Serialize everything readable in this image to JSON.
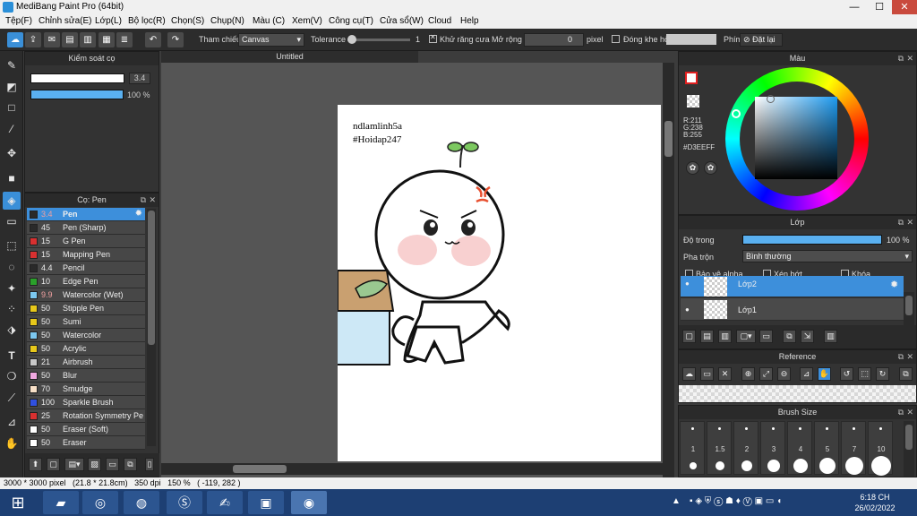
{
  "window": {
    "title": "MediBang Paint Pro (64bit)",
    "minimize": "—",
    "maximize": "☐",
    "close": "✕"
  },
  "menu": [
    "Tệp(F)",
    "Chỉnh sửa(E)",
    "Lớp(L)",
    "Bộ lọc(R)",
    "Chọn(S)",
    "Chụp(N)",
    "Màu (C)",
    "Xem(V)",
    "Công cụ(T)",
    "Cửa sổ(W)",
    "Cloud",
    "Help"
  ],
  "toolbar": {
    "reference_label": "Tham chiếu",
    "reference_value": "Canvas",
    "tolerance_label": "Tolerance",
    "tolerance_value": "1",
    "antialias_label": "Khử răng cưa",
    "expand_label": "Mở rộng",
    "expand_value": "0",
    "expand_unit": "pixel",
    "gap_label": "Đóng khe hở",
    "key_label": "Phím",
    "reset_label": "Đặt lại"
  },
  "brush_control": {
    "title": "Kiểm soát cọ",
    "size": "3.4",
    "opacity": "100 %",
    "size_fraction": 0.95,
    "opacity_fraction": 1.0
  },
  "brush_panel": {
    "title": "Cọ: Pen",
    "brushes": [
      {
        "size": "3.4",
        "name": "Pen",
        "color": "#2a2a2a"
      },
      {
        "size": "45",
        "name": "Pen (Sharp)",
        "color": "#2a2a2a"
      },
      {
        "size": "15",
        "name": "G Pen",
        "color": "#d83030"
      },
      {
        "size": "15",
        "name": "Mapping Pen",
        "color": "#d83030"
      },
      {
        "size": "4.4",
        "name": "Pencil",
        "color": "#2a2a2a"
      },
      {
        "size": "10",
        "name": "Edge Pen",
        "color": "#2aa02a"
      },
      {
        "size": "9.9",
        "name": "Watercolor (Wet)",
        "color": "#7cc8f0"
      },
      {
        "size": "50",
        "name": "Stipple Pen",
        "color": "#e8c81a"
      },
      {
        "size": "50",
        "name": "Sumi",
        "color": "#e8c81a"
      },
      {
        "size": "50",
        "name": "Watercolor",
        "color": "#7cc8f0"
      },
      {
        "size": "50",
        "name": "Acrylic",
        "color": "#e8c81a"
      },
      {
        "size": "21",
        "name": "Airbrush",
        "color": "#c8c8c8"
      },
      {
        "size": "50",
        "name": "Blur",
        "color": "#f0a8e0"
      },
      {
        "size": "70",
        "name": "Smudge",
        "color": "#f8e0c8"
      },
      {
        "size": "100",
        "name": "Sparkle Brush",
        "color": "#3050e0"
      },
      {
        "size": "25",
        "name": "Rotation Symmetry Pe",
        "color": "#d83030"
      },
      {
        "size": "50",
        "name": "Eraser (Soft)",
        "color": "#ffffff"
      },
      {
        "size": "50",
        "name": "Eraser",
        "color": "#ffffff"
      }
    ]
  },
  "document": {
    "tab": "Untitled",
    "text1": "ndlamlinh5a",
    "text2": "#Hoidap247"
  },
  "color_panel": {
    "title": "Màu",
    "r": "R:211",
    "g": "G:238",
    "b": "B:255",
    "hex": "#D3EEFF"
  },
  "layer_panel": {
    "title": "Lớp",
    "opacity_label": "Độ trong",
    "opacity_value": "100 %",
    "blend_label": "Pha trộn",
    "blend_value": "Bình thường",
    "protect_alpha": "Bảo vệ alpha",
    "clipping": "Xén bớt",
    "lock": "Khóa",
    "layers": [
      "Lớp2",
      "Lớp1"
    ]
  },
  "reference_panel": {
    "title": "Reference"
  },
  "brush_size_panel": {
    "title": "Brush Size",
    "sizes": [
      "1",
      "1.5",
      "2",
      "3",
      "4",
      "5",
      "7",
      "10"
    ]
  },
  "status": {
    "text": "3000 * 3000 pixel   (21.8 * 21.8cm)   350 dpi   150 %   ( -119, 282 )"
  },
  "taskbar": {
    "time": "6:18 CH",
    "date": "26/02/2022"
  },
  "colors": {
    "accent": "#3d8fdb",
    "panel": "#333333",
    "toolbar": "#2c2c2c",
    "taskbar": "#1d3f73"
  }
}
